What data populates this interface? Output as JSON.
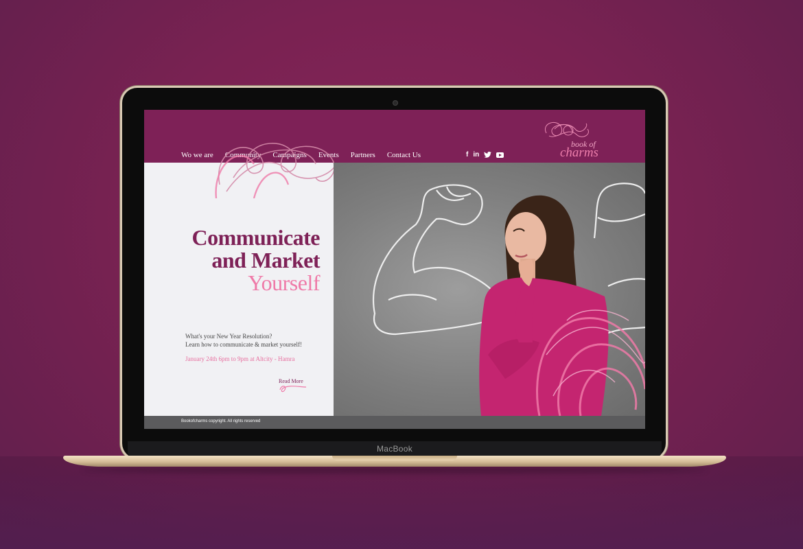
{
  "nav": {
    "items": [
      {
        "label": "Wo we are"
      },
      {
        "label": "Community"
      },
      {
        "label": "Campaigns"
      },
      {
        "label": "Events"
      },
      {
        "label": "Partners"
      },
      {
        "label": "Contact Us"
      }
    ]
  },
  "social": {
    "facebook": "f",
    "linkedin": "in",
    "twitter": "twitter-icon",
    "youtube": "youtube-icon"
  },
  "logo": {
    "line1": "book of",
    "line2": "charms"
  },
  "hero": {
    "headline_line1": "Communicate",
    "headline_line2": "and Market",
    "headline_line3": "Yourself",
    "desc_line1": "What's your New Year Resolution?",
    "desc_line2": "Learn how to communicate & market yourself!",
    "date": "January 24th 6pm to 9pm at Altcity - Hamra",
    "read_more": "Read More"
  },
  "footer": {
    "copyright": "Bookofcharms copyright. All rights reserved"
  },
  "device": {
    "brand": "MacBook"
  },
  "colors": {
    "brand": "#7e2157",
    "accent": "#ef7aa8",
    "footer": "#5b5b5d"
  }
}
